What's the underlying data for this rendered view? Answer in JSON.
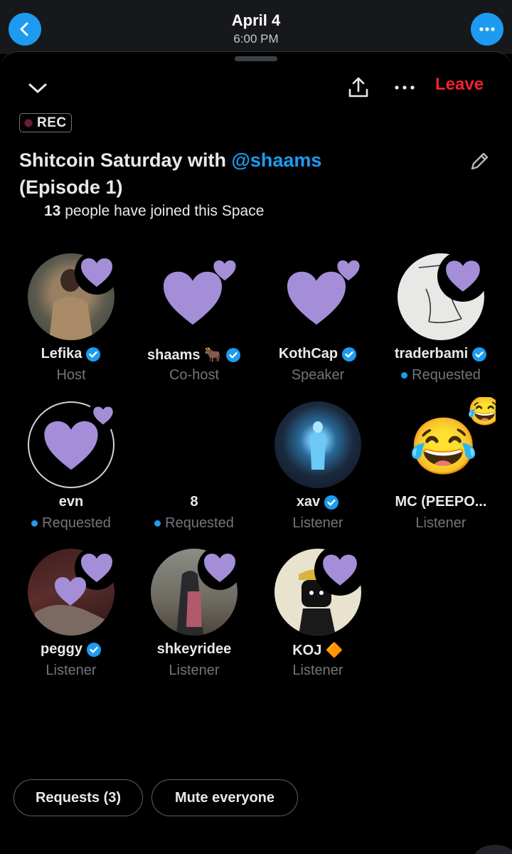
{
  "header": {
    "date": "April 4",
    "time": "6:00 PM"
  },
  "space": {
    "rec_label": "REC",
    "title_prefix": "Shitcoin Saturday with ",
    "title_handle": "@shaams",
    "title_suffix": "(Episode 1)",
    "joined_count": "13",
    "joined_text": " people have joined this Space",
    "leave_label": "Leave"
  },
  "participants": [
    {
      "name": "Lefika",
      "role": "Host",
      "verified": true,
      "requested": false
    },
    {
      "name": "shaams 🐂",
      "role": "Co-host",
      "verified": true,
      "requested": false
    },
    {
      "name": "KothCap",
      "role": "Speaker",
      "verified": true,
      "requested": false
    },
    {
      "name": "traderbami",
      "role": "Requested",
      "verified": true,
      "requested": true
    },
    {
      "name": "evn",
      "role": "Requested",
      "verified": false,
      "requested": true
    },
    {
      "name": "8",
      "role": "Requested",
      "verified": false,
      "requested": true
    },
    {
      "name": "xav",
      "role": "Listener",
      "verified": true,
      "requested": false
    },
    {
      "name": "MC (PEEPO...",
      "role": "Listener",
      "verified": false,
      "requested": false
    },
    {
      "name": "peggy",
      "role": "Listener",
      "verified": true,
      "requested": false
    },
    {
      "name": "shkeyridee",
      "role": "Listener",
      "verified": false,
      "requested": false
    },
    {
      "name": "KOJ 🔶",
      "role": "Listener",
      "verified": false,
      "requested": false
    }
  ],
  "footer": {
    "requests_label": "Requests (3)",
    "mute_label": "Mute everyone"
  },
  "colors": {
    "accent": "#1d9bf0",
    "leave": "#f4212e",
    "heart": "#a48ed8",
    "muted_text": "#71767b"
  },
  "icons": [
    "back-chevron-icon",
    "more-dots-icon",
    "collapse-chevron-icon",
    "share-icon",
    "edit-pencil-icon",
    "heart-reaction-icon",
    "verified-badge-icon"
  ]
}
